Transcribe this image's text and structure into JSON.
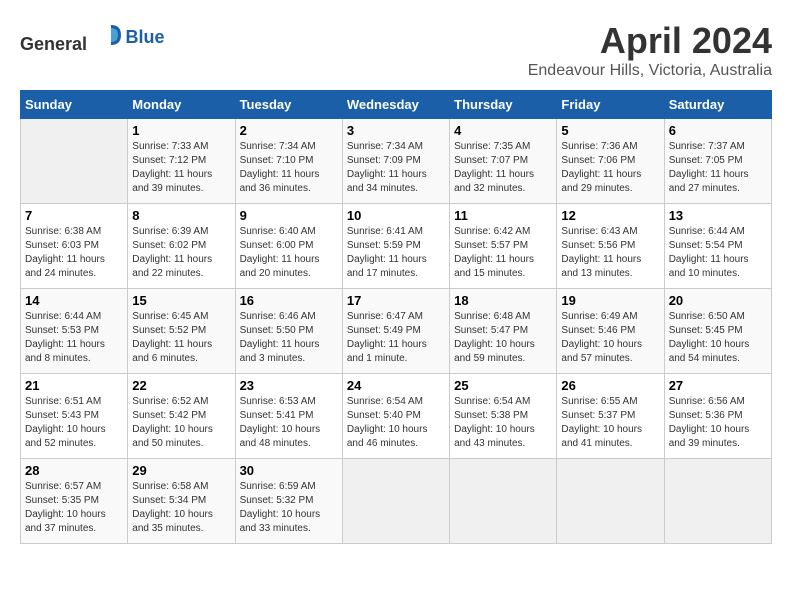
{
  "header": {
    "logo_general": "General",
    "logo_blue": "Blue",
    "title": "April 2024",
    "subtitle": "Endeavour Hills, Victoria, Australia"
  },
  "calendar": {
    "days_of_week": [
      "Sunday",
      "Monday",
      "Tuesday",
      "Wednesday",
      "Thursday",
      "Friday",
      "Saturday"
    ],
    "weeks": [
      [
        {
          "day": "",
          "info": ""
        },
        {
          "day": "1",
          "info": "Sunrise: 7:33 AM\nSunset: 7:12 PM\nDaylight: 11 hours\nand 39 minutes."
        },
        {
          "day": "2",
          "info": "Sunrise: 7:34 AM\nSunset: 7:10 PM\nDaylight: 11 hours\nand 36 minutes."
        },
        {
          "day": "3",
          "info": "Sunrise: 7:34 AM\nSunset: 7:09 PM\nDaylight: 11 hours\nand 34 minutes."
        },
        {
          "day": "4",
          "info": "Sunrise: 7:35 AM\nSunset: 7:07 PM\nDaylight: 11 hours\nand 32 minutes."
        },
        {
          "day": "5",
          "info": "Sunrise: 7:36 AM\nSunset: 7:06 PM\nDaylight: 11 hours\nand 29 minutes."
        },
        {
          "day": "6",
          "info": "Sunrise: 7:37 AM\nSunset: 7:05 PM\nDaylight: 11 hours\nand 27 minutes."
        }
      ],
      [
        {
          "day": "7",
          "info": "Sunrise: 6:38 AM\nSunset: 6:03 PM\nDaylight: 11 hours\nand 24 minutes."
        },
        {
          "day": "8",
          "info": "Sunrise: 6:39 AM\nSunset: 6:02 PM\nDaylight: 11 hours\nand 22 minutes."
        },
        {
          "day": "9",
          "info": "Sunrise: 6:40 AM\nSunset: 6:00 PM\nDaylight: 11 hours\nand 20 minutes."
        },
        {
          "day": "10",
          "info": "Sunrise: 6:41 AM\nSunset: 5:59 PM\nDaylight: 11 hours\nand 17 minutes."
        },
        {
          "day": "11",
          "info": "Sunrise: 6:42 AM\nSunset: 5:57 PM\nDaylight: 11 hours\nand 15 minutes."
        },
        {
          "day": "12",
          "info": "Sunrise: 6:43 AM\nSunset: 5:56 PM\nDaylight: 11 hours\nand 13 minutes."
        },
        {
          "day": "13",
          "info": "Sunrise: 6:44 AM\nSunset: 5:54 PM\nDaylight: 11 hours\nand 10 minutes."
        }
      ],
      [
        {
          "day": "14",
          "info": "Sunrise: 6:44 AM\nSunset: 5:53 PM\nDaylight: 11 hours\nand 8 minutes."
        },
        {
          "day": "15",
          "info": "Sunrise: 6:45 AM\nSunset: 5:52 PM\nDaylight: 11 hours\nand 6 minutes."
        },
        {
          "day": "16",
          "info": "Sunrise: 6:46 AM\nSunset: 5:50 PM\nDaylight: 11 hours\nand 3 minutes."
        },
        {
          "day": "17",
          "info": "Sunrise: 6:47 AM\nSunset: 5:49 PM\nDaylight: 11 hours\nand 1 minute."
        },
        {
          "day": "18",
          "info": "Sunrise: 6:48 AM\nSunset: 5:47 PM\nDaylight: 10 hours\nand 59 minutes."
        },
        {
          "day": "19",
          "info": "Sunrise: 6:49 AM\nSunset: 5:46 PM\nDaylight: 10 hours\nand 57 minutes."
        },
        {
          "day": "20",
          "info": "Sunrise: 6:50 AM\nSunset: 5:45 PM\nDaylight: 10 hours\nand 54 minutes."
        }
      ],
      [
        {
          "day": "21",
          "info": "Sunrise: 6:51 AM\nSunset: 5:43 PM\nDaylight: 10 hours\nand 52 minutes."
        },
        {
          "day": "22",
          "info": "Sunrise: 6:52 AM\nSunset: 5:42 PM\nDaylight: 10 hours\nand 50 minutes."
        },
        {
          "day": "23",
          "info": "Sunrise: 6:53 AM\nSunset: 5:41 PM\nDaylight: 10 hours\nand 48 minutes."
        },
        {
          "day": "24",
          "info": "Sunrise: 6:54 AM\nSunset: 5:40 PM\nDaylight: 10 hours\nand 46 minutes."
        },
        {
          "day": "25",
          "info": "Sunrise: 6:54 AM\nSunset: 5:38 PM\nDaylight: 10 hours\nand 43 minutes."
        },
        {
          "day": "26",
          "info": "Sunrise: 6:55 AM\nSunset: 5:37 PM\nDaylight: 10 hours\nand 41 minutes."
        },
        {
          "day": "27",
          "info": "Sunrise: 6:56 AM\nSunset: 5:36 PM\nDaylight: 10 hours\nand 39 minutes."
        }
      ],
      [
        {
          "day": "28",
          "info": "Sunrise: 6:57 AM\nSunset: 5:35 PM\nDaylight: 10 hours\nand 37 minutes."
        },
        {
          "day": "29",
          "info": "Sunrise: 6:58 AM\nSunset: 5:34 PM\nDaylight: 10 hours\nand 35 minutes."
        },
        {
          "day": "30",
          "info": "Sunrise: 6:59 AM\nSunset: 5:32 PM\nDaylight: 10 hours\nand 33 minutes."
        },
        {
          "day": "",
          "info": ""
        },
        {
          "day": "",
          "info": ""
        },
        {
          "day": "",
          "info": ""
        },
        {
          "day": "",
          "info": ""
        }
      ]
    ]
  }
}
